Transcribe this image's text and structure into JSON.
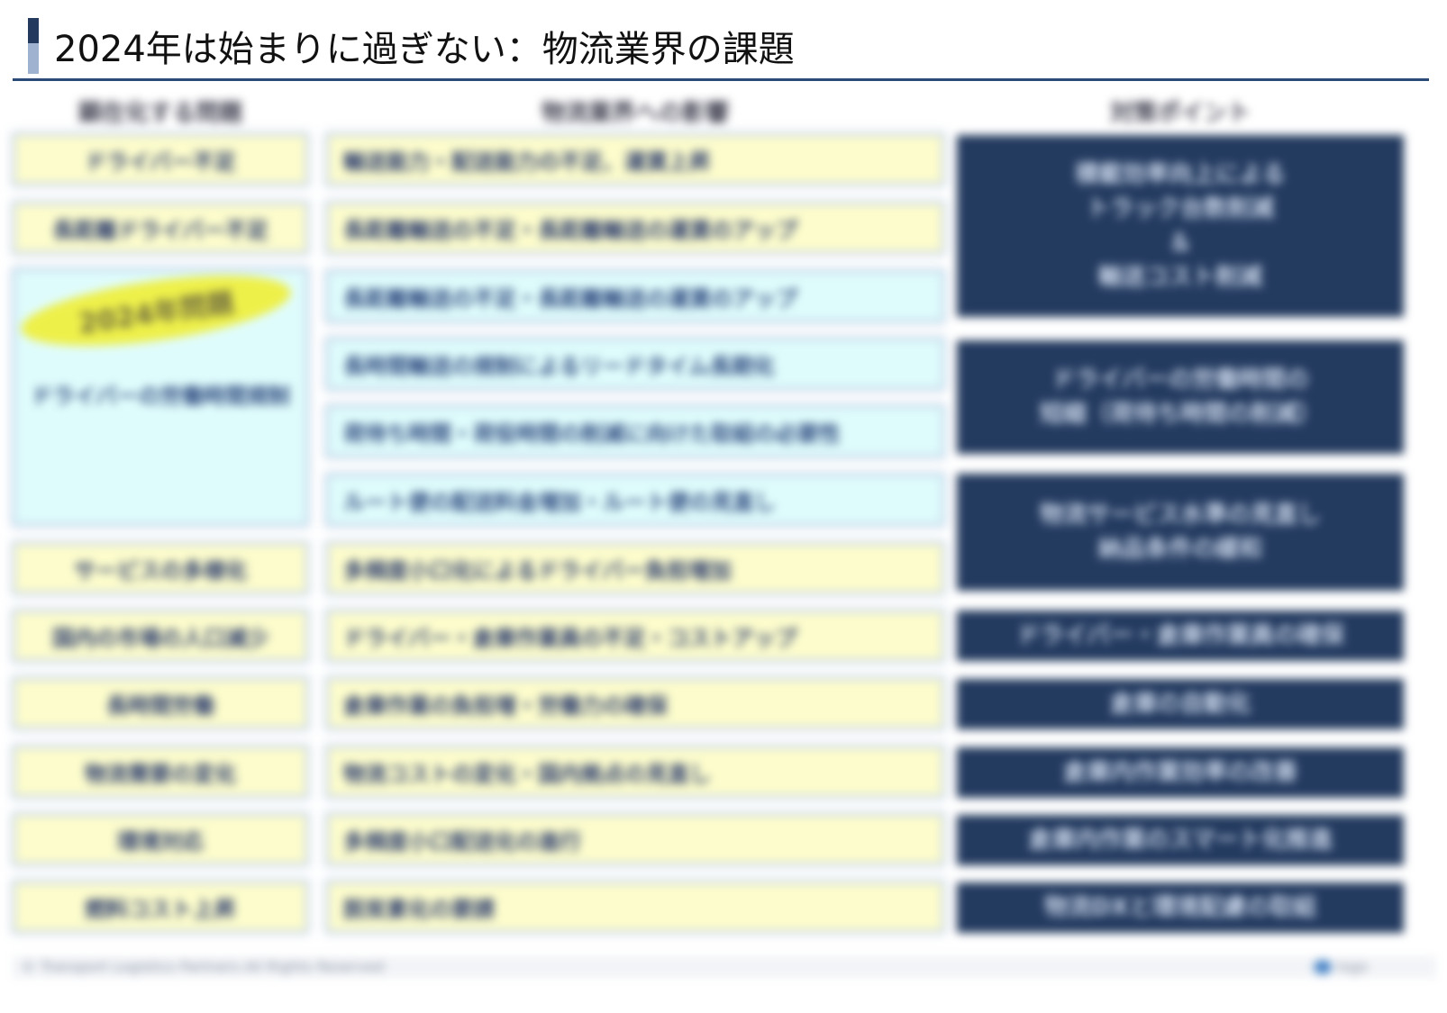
{
  "slide": {
    "title": "2024年は始まりに過ぎない：物流業界の課題"
  },
  "headers": {
    "col1": "顕在化する問題",
    "col2": "物流業界への影響",
    "col3": "対策ポイント"
  },
  "issues": [
    "ドライバー不足",
    "長距離ドライバー不足",
    "サービスの多様化",
    "国内の市場の人口減少",
    "長時間労働",
    "物流需要の変化",
    "環境対応",
    "燃料コスト上昇"
  ],
  "special_issue": {
    "badge": "2024年問題",
    "label": "ドライバーの労働時間規制"
  },
  "impacts": [
    "輸送能力・配送能力の不足、運賃上昇",
    "長距離輸送の不足・長距離輸送の運賃のアップ",
    "長距離輸送の不足・長距離輸送の運賃のアップ",
    "長時間輸送の規制によるリードタイム長期化",
    "荷待ち時間・荷役時間の削減に向けた取組の必要性",
    "ルート便の配送料金増加・ルート便の見直し",
    "多頻度小口化によるドライバー負担増加",
    "ドライバー・倉庫作業員の不足・コストアップ",
    "倉庫作業の負担増・労働力の確保",
    "物流コストの変化・国内拠点の見直し",
    "多頻度小口配送化の進行",
    "脱炭素化の要請"
  ],
  "points": [
    "積載効率向上による\nトラック台数削減\n＆\n輸送コスト削減",
    "ドライバーの労働時間の\n短縮（荷待ち時間の削減）",
    "物流サービス水準の見直し\n納品条件の緩和",
    "ドライバー・倉庫作業員の確保",
    "倉庫の自動化",
    "倉庫内作業効率の改善",
    "倉庫内作業のスマート化推進",
    "物流DXと環境配慮の取組"
  ],
  "footer": {
    "copyright": "© Transport Logistics Partners All Rights Reserved",
    "logo_text": "logo"
  }
}
